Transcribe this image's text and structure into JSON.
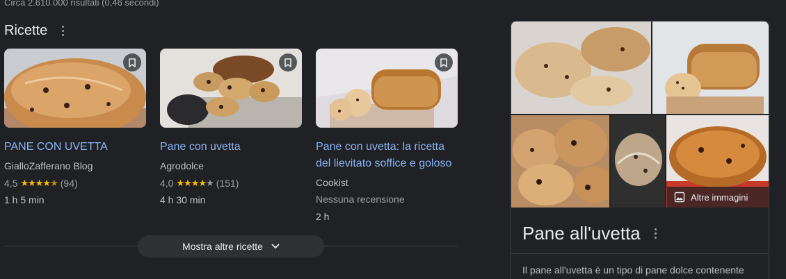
{
  "results_stats": "Circa 2.610.000 risultati (0,46 secondi)",
  "recipes": {
    "heading": "Ricette",
    "cards": [
      {
        "title_lines": [
          "PANE CON UVETTA"
        ],
        "source": "GialloZafferano Blog",
        "rating": "4,5",
        "stars": "★★★★",
        "half": "★",
        "off": "",
        "reviews": "(94)",
        "time": "1 h 5 min"
      },
      {
        "title_lines": [
          "Pane con uvetta"
        ],
        "source": "Agrodolce",
        "rating": "4,0",
        "stars": "★★★★",
        "half": "",
        "off": "★",
        "reviews": "(151)",
        "time": "4 h 30 min"
      },
      {
        "title_lines": [
          "Pane con uvetta: la ricetta",
          "del lievitato soffice e goloso"
        ],
        "source": "Cookist",
        "no_reviews": "Nessuna recensione",
        "time": "2 h"
      }
    ],
    "more_button": "Mostra altre ricette"
  },
  "knowledge_panel": {
    "more_images": "Altre immagini",
    "title": "Pane all'uvetta",
    "description": "Il pane all'uvetta è un tipo di pane dolce contenente"
  },
  "colors": {
    "link": "#8ab4f8",
    "star": "#fbbc04",
    "background": "#202124"
  }
}
